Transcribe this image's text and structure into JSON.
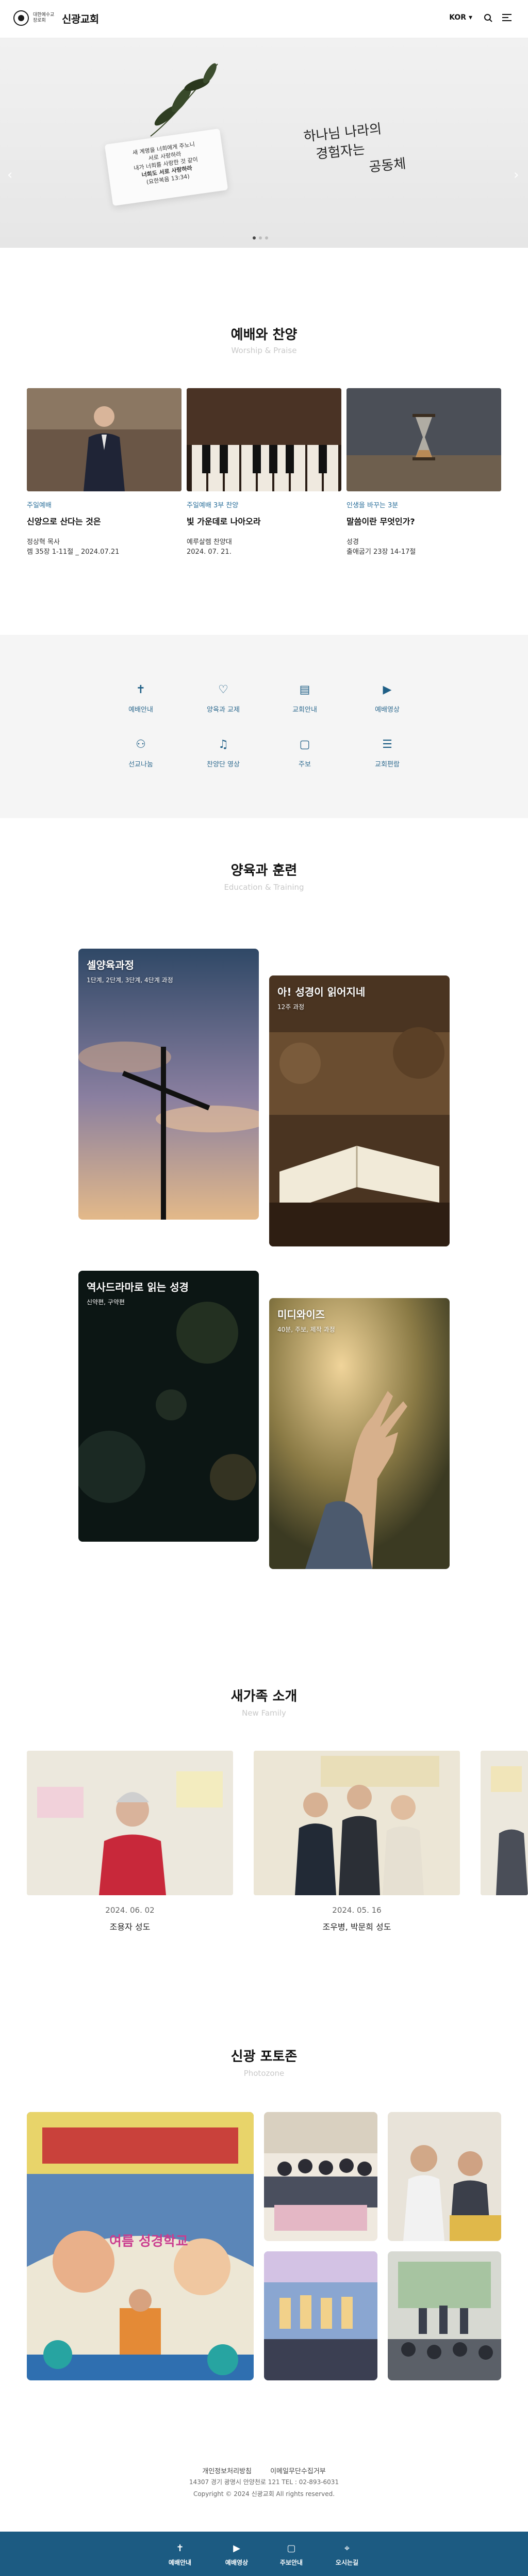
{
  "header": {
    "logo_sub": "대한예수교 장로회",
    "logo_name": "신광교회",
    "lang": "KOR",
    "lang_arrow": "▾",
    "search_icon": "search-icon",
    "menu_icon": "hamburger-icon"
  },
  "hero": {
    "card_lines": [
      "새 계명을 너희에게 주노니",
      "서로 사랑하라",
      "내가 너희를 사랑한 것 같이",
      "너희도 서로 사랑하라"
    ],
    "card_ref": "(요한복음 13:34)",
    "calligraphy": [
      "하나님 나라의",
      "경험자는",
      "공동체"
    ],
    "prev_arrow": "‹",
    "next_arrow": "›"
  },
  "worship": {
    "title": "예배와 찬양",
    "subtitle": "Worship & Praise",
    "cards": [
      {
        "category": "주일예배",
        "title": "신앙으로 산다는 것은",
        "meta1": "정상혁 목사",
        "meta2": "렘 35장 1-11절 _ 2024.07.21"
      },
      {
        "category": "주일예배 3부 찬양",
        "title": "빛 가운데로 나아오라",
        "meta1": "예루살렘 찬양대",
        "meta2": "2024. 07. 21."
      },
      {
        "category": "인생을 바꾸는 3분",
        "title": "말씀이란 무엇인가?",
        "meta1": "성경",
        "meta2": "출애굽기 23장 14-17절"
      }
    ]
  },
  "quick_menu": {
    "items": [
      {
        "label": "예배안내",
        "icon": "cross-icon",
        "glyph": "✝"
      },
      {
        "label": "양육과 교제",
        "icon": "heart-hand-icon",
        "glyph": "♡"
      },
      {
        "label": "교회안내",
        "icon": "book-icon",
        "glyph": "▤"
      },
      {
        "label": "예배영상",
        "icon": "video-icon",
        "glyph": "▶"
      },
      {
        "label": "선교나눔",
        "icon": "people-icon",
        "glyph": "⚇"
      },
      {
        "label": "찬양단 영상",
        "icon": "music-video-icon",
        "glyph": "♫"
      },
      {
        "label": "주보",
        "icon": "bulletin-icon",
        "glyph": "▢"
      },
      {
        "label": "교회편람",
        "icon": "clipboard-icon",
        "glyph": "☰"
      }
    ]
  },
  "education": {
    "title": "양육과 훈련",
    "subtitle": "Education & Training",
    "cards": [
      {
        "title": "셀양육과정",
        "desc": "1단계, 2단계, 3단계, 4단계 과정"
      },
      {
        "title": "아! 성경이 읽어지네",
        "desc": "12주 과정"
      },
      {
        "title": "역사드라마로 읽는 성경",
        "desc": "신약편, 구약편"
      },
      {
        "title": "미디와이즈",
        "desc": "40분, 주보, 제작 과정"
      }
    ]
  },
  "new_family": {
    "title": "새가족 소개",
    "subtitle": "New Family",
    "cards": [
      {
        "date": "2024. 06. 02",
        "names": "조용자 성도"
      },
      {
        "date": "2024. 05. 16",
        "names": "조우병, 박문희 성도"
      }
    ]
  },
  "photozone": {
    "title": "신광 포토존",
    "subtitle": "Photozone",
    "banner_text": "여름 성경학교"
  },
  "footer": {
    "links": [
      "개인정보처리방침",
      "이메일무단수집거부"
    ],
    "address": "14307 경기 광명시 안양천로 121 TEL : 02-893-6031",
    "copyright": "Copyright © 2024 신광교회 All rights reserved."
  },
  "bottom_nav": {
    "items": [
      {
        "label": "예배안내",
        "icon": "cross-icon",
        "glyph": "✝"
      },
      {
        "label": "예배영상",
        "icon": "video-icon",
        "glyph": "▶"
      },
      {
        "label": "주보안내",
        "icon": "bulletin-icon",
        "glyph": "▢"
      },
      {
        "label": "오시는길",
        "icon": "location-icon",
        "glyph": "⌖"
      }
    ]
  }
}
